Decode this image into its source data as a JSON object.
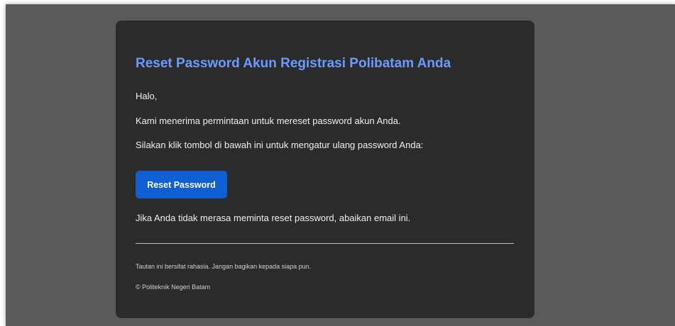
{
  "email": {
    "title": "Reset Password Akun Registrasi Polibatam Anda",
    "greeting": "Halo,",
    "line1": "Kami menerima permintaan untuk mereset password akun Anda.",
    "line2": "Silakan klik tombol di bawah ini untuk mengatur ulang password Anda:",
    "button_label": "Reset Password",
    "ignore_note": "Jika Anda tidak merasa meminta reset password, abaikan email ini.",
    "footer_secret": "Tautan ini bersifat rahasia. Jangan bagikan kepada siapa pun.",
    "footer_copyright": "© Politeknik Negeri Batam"
  },
  "colors": {
    "page_background": "#5a5a5a",
    "card_background": "#2b2b2b",
    "title": "#6a9bff",
    "button": "#0f5fd3"
  }
}
